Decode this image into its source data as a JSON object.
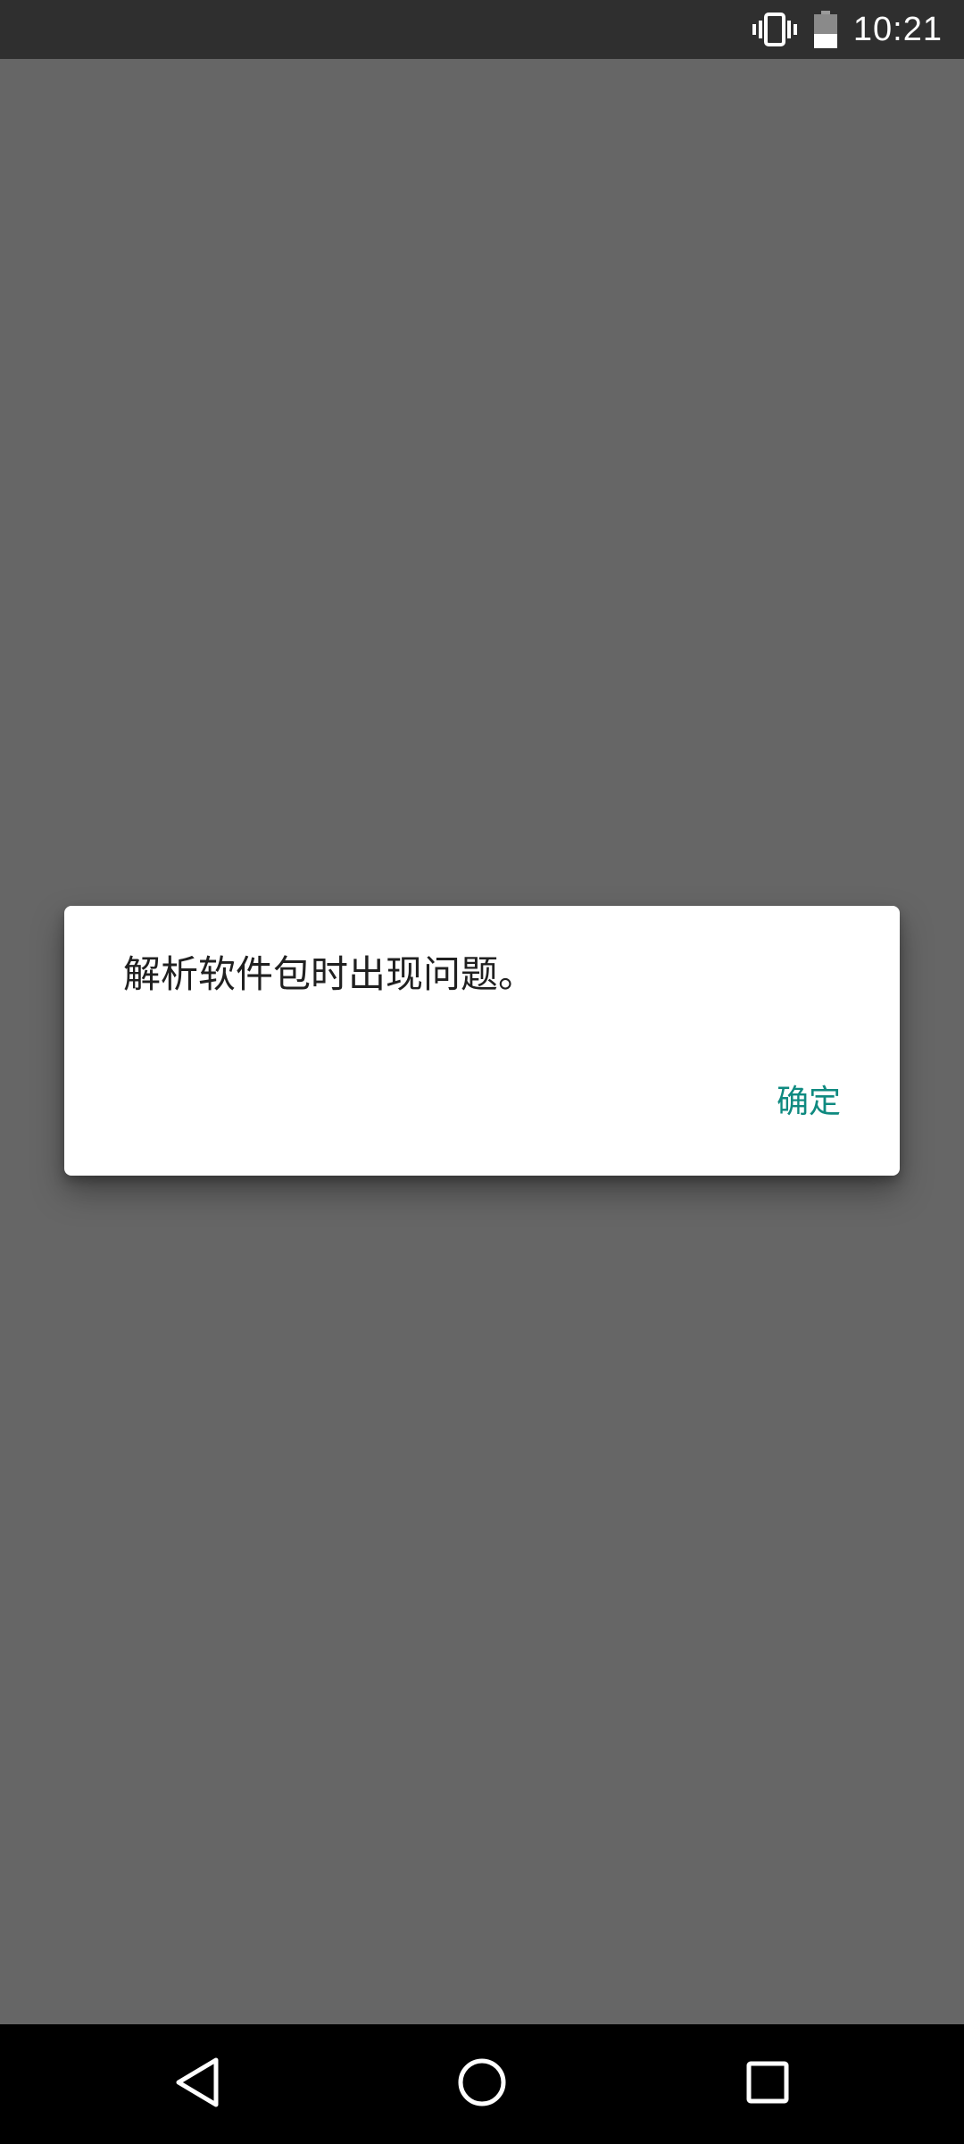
{
  "status_bar": {
    "time": "10:21",
    "icons": [
      "vibrate-icon",
      "battery-icon"
    ]
  },
  "dialog": {
    "message": "解析软件包时出现问题。",
    "ok_label": "确定",
    "accent_color": "#0f8a80"
  },
  "nav_bar": {
    "buttons": [
      "back-icon",
      "home-icon",
      "recents-icon"
    ]
  },
  "colors": {
    "scrim": "#666666",
    "status_bar": "#2f2f2f",
    "nav_bar": "#000000",
    "dialog_bg": "#ffffff"
  }
}
